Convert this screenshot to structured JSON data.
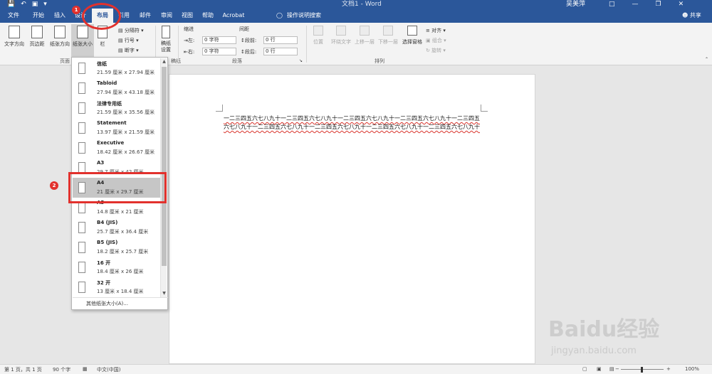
{
  "titlebar": {
    "doc_title": "文档1 - Word",
    "user_name": "吴美萍",
    "qat_icons": [
      "save-icon",
      "undo-icon",
      "print-preview-icon",
      "customize-icon"
    ]
  },
  "tabs": [
    "文件",
    "开始",
    "插入",
    "设计",
    "布局",
    "引用",
    "邮件",
    "审阅",
    "视图",
    "帮助",
    "Acrobat"
  ],
  "active_tab": "布局",
  "tell_me": "操作说明搜索",
  "share": "共享",
  "ribbon": {
    "page_setup": {
      "text_direction": "文字方向",
      "margins": "页边距",
      "orientation": "纸张方向",
      "size": "纸张大小",
      "columns": "栏",
      "breaks": "分隔符",
      "line_numbers": "行号",
      "hyphenation": "断字",
      "group_label": "页面"
    },
    "draft": {
      "label": "稿纸设置",
      "group_label": "稿纸"
    },
    "paragraph": {
      "indent_label": "缩进",
      "spacing_label": "间距",
      "left_label": "左:",
      "right_label": "右:",
      "before_label": "段前:",
      "after_label": "段后:",
      "left_value": "0 字符",
      "right_value": "0 字符",
      "before_value": "0 行",
      "after_value": "0 行",
      "group_label": "段落"
    },
    "arrange": {
      "position": "位置",
      "wrap_text": "环绕文字",
      "bring_forward": "上移一层",
      "send_backward": "下移一层",
      "selection_pane": "选择窗格",
      "align": "对齐",
      "group": "组合",
      "rotate": "旋转",
      "group_label": "排列"
    }
  },
  "paper_sizes": [
    {
      "name": "信纸",
      "dims": "21.59 厘米 x 27.94 厘米"
    },
    {
      "name": "Tabloid",
      "dims": "27.94 厘米 x 43.18 厘米"
    },
    {
      "name": "法律专用纸",
      "dims": "21.59 厘米 x 35.56 厘米"
    },
    {
      "name": "Statement",
      "dims": "13.97 厘米 x 21.59 厘米"
    },
    {
      "name": "Executive",
      "dims": "18.42 厘米 x 26.67 厘米"
    },
    {
      "name": "A3",
      "dims": "29.7 厘米 x 42 厘米"
    },
    {
      "name": "A4",
      "dims": "21 厘米 x 29.7 厘米"
    },
    {
      "name": "A5",
      "dims": "14.8 厘米 x 21 厘米"
    },
    {
      "name": "B4 (JIS)",
      "dims": "25.7 厘米 x 36.4 厘米"
    },
    {
      "name": "B5 (JIS)",
      "dims": "18.2 厘米 x 25.7 厘米"
    },
    {
      "name": "16 开",
      "dims": "18.4 厘米 x 26 厘米"
    },
    {
      "name": "32 开",
      "dims": "13 厘米 x 18.4 厘米"
    }
  ],
  "selected_paper": "A4",
  "more_sizes": "其他纸张大小(A)...",
  "document_text": "一二三四五六七八九十一二三四五六七八九十一二三四五六七八九十一二三四五六七八九十一二三四五六七八九十一二三四五六七八九十一二三四五六七八九十一二三四五六七八九十一二三四五六七八九十",
  "annotations": {
    "badge_1": "1",
    "badge_2": "2",
    "color": "#e2312d"
  },
  "statusbar": {
    "page_info": "第 1 页，共 1 页",
    "word_count": "90 个字",
    "language": "中文(中国)",
    "zoom": "100%"
  },
  "watermark": {
    "main": "Baidu经验",
    "sub": "jingyan.baidu.com"
  },
  "colors": {
    "ribbon_blue": "#2b579a",
    "highlight_red": "#e2312d"
  }
}
